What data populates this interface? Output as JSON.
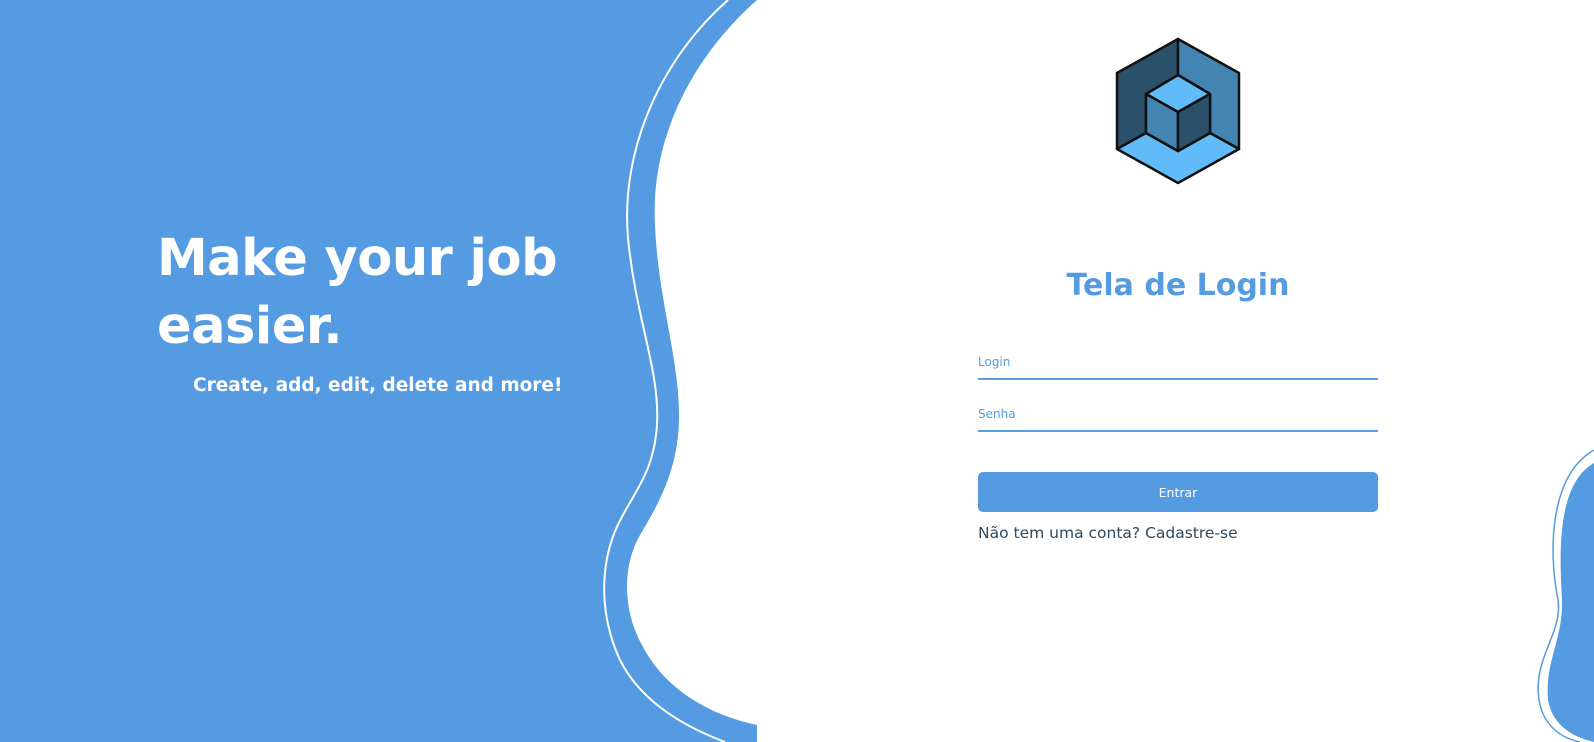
{
  "hero": {
    "title": "Make your job easier.",
    "subtitle": "Create, add, edit, delete and more!"
  },
  "login": {
    "title": "Tela de Login",
    "login_placeholder": "Login",
    "password_placeholder": "Senha",
    "login_value": "",
    "password_value": "",
    "submit_label": "Entrar",
    "signup_prompt": "Não tem uma conta?",
    "signup_link": "Cadastre-se"
  },
  "logo": {
    "icon": "cube-logo-icon"
  },
  "colors": {
    "primary": "#549be1",
    "background": "#ffffff",
    "logo_dark": "#2b5069",
    "logo_mid": "#4484b3",
    "logo_light": "#62bbf9",
    "link_text": "#2e4a5e"
  }
}
